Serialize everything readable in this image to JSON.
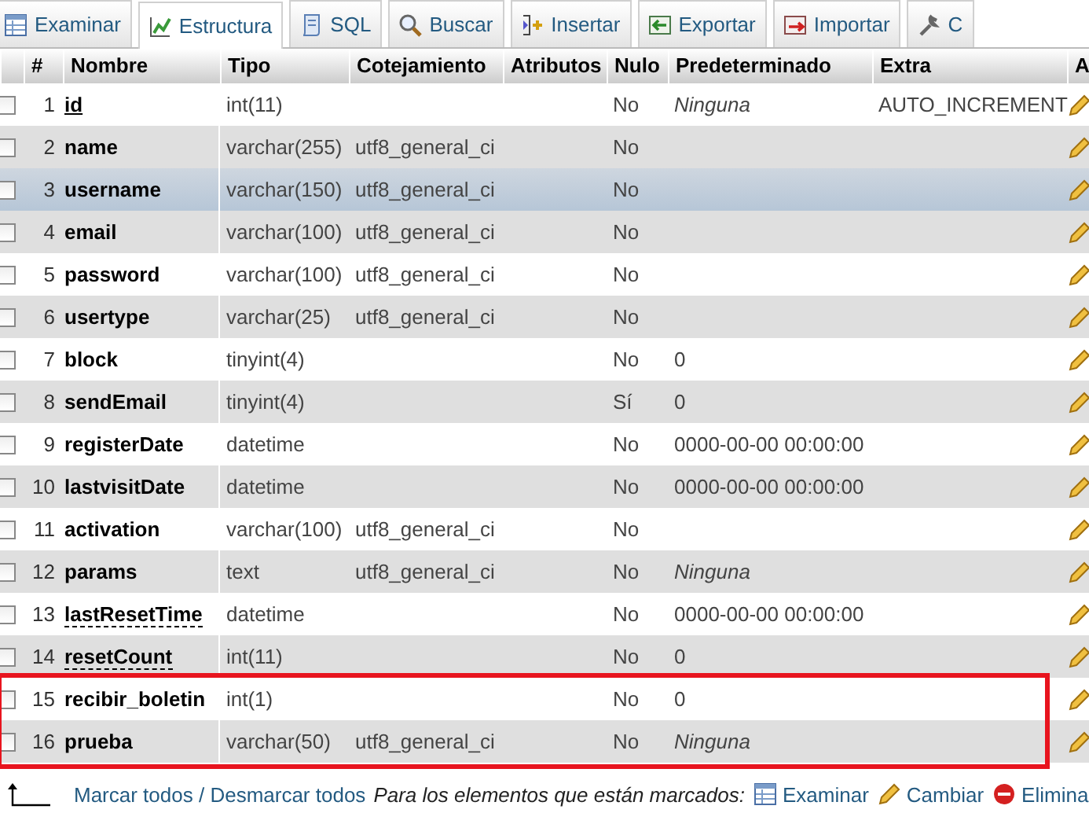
{
  "tabs": [
    {
      "label": "Examinar",
      "kind": "browse",
      "selected": false
    },
    {
      "label": "Estructura",
      "kind": "structure",
      "selected": true
    },
    {
      "label": "SQL",
      "kind": "sql",
      "selected": false
    },
    {
      "label": "Buscar",
      "kind": "search",
      "selected": false
    },
    {
      "label": "Insertar",
      "kind": "insert",
      "selected": false
    },
    {
      "label": "Exportar",
      "kind": "export",
      "selected": false
    },
    {
      "label": "Importar",
      "kind": "import",
      "selected": false
    },
    {
      "label": "C",
      "kind": "operations",
      "selected": false
    }
  ],
  "table": {
    "columns": [
      "#",
      "Nombre",
      "Tipo",
      "Cotejamiento",
      "Atributos",
      "Nulo",
      "Predeterminado",
      "Extra",
      "A"
    ],
    "rows": [
      {
        "number": "1",
        "name": "id",
        "kind": "primary",
        "type": "int(11)",
        "null": "No",
        "default": "Ninguna",
        "default_italic": true,
        "extra": "AUTO_INCREMENT",
        "selected": false,
        "highlighted": false
      },
      {
        "number": "2",
        "name": "name",
        "kind": "plain",
        "type": "varchar(255)",
        "collation": "utf8_general_ci",
        "null": "No",
        "selected": false,
        "highlighted": false
      },
      {
        "number": "3",
        "name": "username",
        "kind": "plain",
        "type": "varchar(150)",
        "collation": "utf8_general_ci",
        "null": "No",
        "selected": true,
        "highlighted": false
      },
      {
        "number": "4",
        "name": "email",
        "kind": "plain",
        "type": "varchar(100)",
        "collation": "utf8_general_ci",
        "null": "No",
        "selected": false,
        "highlighted": false
      },
      {
        "number": "5",
        "name": "password",
        "kind": "plain",
        "type": "varchar(100)",
        "collation": "utf8_general_ci",
        "null": "No",
        "selected": false,
        "highlighted": false
      },
      {
        "number": "6",
        "name": "usertype",
        "kind": "plain",
        "type": "varchar(25)",
        "collation": "utf8_general_ci",
        "null": "No",
        "selected": false,
        "highlighted": false
      },
      {
        "number": "7",
        "name": "block",
        "kind": "plain",
        "type": "tinyint(4)",
        "null": "No",
        "default": "0",
        "default_italic": false,
        "selected": false,
        "highlighted": false
      },
      {
        "number": "8",
        "name": "sendEmail",
        "kind": "plain",
        "type": "tinyint(4)",
        "null": "Sí",
        "default": "0",
        "default_italic": false,
        "selected": false,
        "highlighted": false
      },
      {
        "number": "9",
        "name": "registerDate",
        "kind": "plain",
        "type": "datetime",
        "null": "No",
        "default": "0000-00-00 00:00:00",
        "default_italic": false,
        "selected": false,
        "highlighted": false
      },
      {
        "number": "10",
        "name": "lastvisitDate",
        "kind": "plain",
        "type": "datetime",
        "null": "No",
        "default": "0000-00-00 00:00:00",
        "default_italic": false,
        "selected": false,
        "highlighted": false
      },
      {
        "number": "11",
        "name": "activation",
        "kind": "plain",
        "type": "varchar(100)",
        "collation": "utf8_general_ci",
        "null": "No",
        "selected": false,
        "highlighted": false
      },
      {
        "number": "12",
        "name": "params",
        "kind": "plain",
        "type": "text",
        "collation": "utf8_general_ci",
        "null": "No",
        "default": "Ninguna",
        "default_italic": true,
        "selected": false,
        "highlighted": false
      },
      {
        "number": "13",
        "name": "lastResetTime",
        "kind": "index",
        "type": "datetime",
        "null": "No",
        "default": "0000-00-00 00:00:00",
        "default_italic": false,
        "selected": false,
        "highlighted": false
      },
      {
        "number": "14",
        "name": "resetCount",
        "kind": "index",
        "type": "int(11)",
        "null": "No",
        "default": "0",
        "default_italic": false,
        "selected": false,
        "highlighted": false
      },
      {
        "number": "15",
        "name": "recibir_boletin",
        "kind": "plain",
        "type": "int(1)",
        "null": "No",
        "default": "0",
        "default_italic": false,
        "selected": false,
        "highlighted": true
      },
      {
        "number": "16",
        "name": "prueba",
        "kind": "plain",
        "type": "varchar(50)",
        "collation": "utf8_general_ci",
        "null": "No",
        "default": "Ninguna",
        "default_italic": true,
        "selected": false,
        "highlighted": true
      }
    ]
  },
  "footer": {
    "check_all": "Marcar todos / Desmarcar todos",
    "prompt": "Para los elementos que están marcados:",
    "actions": [
      {
        "label": "Examinar",
        "kind": "browse"
      },
      {
        "label": "Cambiar",
        "kind": "change"
      },
      {
        "label": "Elimina",
        "kind": "drop"
      }
    ]
  }
}
